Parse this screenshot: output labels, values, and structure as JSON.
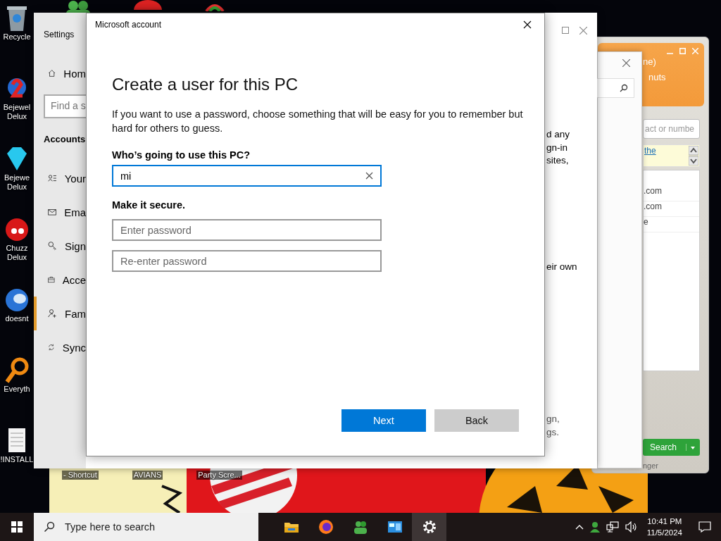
{
  "desktop_icons": [
    {
      "kind": "bin",
      "lines": [
        "Recycle"
      ]
    },
    {
      "kind": "gem",
      "lines": [
        "Bejewel",
        "Delux"
      ]
    },
    {
      "kind": "diamond",
      "lines": [
        "Bejewe",
        "Delux"
      ]
    },
    {
      "kind": "blob",
      "lines": [
        "Chuzz",
        "Delux"
      ]
    },
    {
      "kind": "globe",
      "lines": [
        "doesnt"
      ]
    },
    {
      "kind": "magnifier",
      "lines": [
        "Everyth"
      ]
    },
    {
      "kind": "document",
      "lines": [
        "!INSTALL"
      ]
    }
  ],
  "wallpaper_icon_labels": [
    "- Shortcut",
    "AVIANS",
    "Party Scre..."
  ],
  "settings": {
    "title": "Settings",
    "search_placeholder": "Find a s",
    "section": "Accounts",
    "nav": [
      {
        "kind": "home",
        "label": "Hom",
        "selected": false
      },
      {
        "kind": "person-list",
        "label": "Your",
        "selected": false
      },
      {
        "kind": "mail",
        "label": "Ema",
        "selected": false
      },
      {
        "kind": "key",
        "label": "Sign",
        "selected": false
      },
      {
        "kind": "briefcase",
        "label": "Acce",
        "selected": false
      },
      {
        "kind": "person-add",
        "label": "Fam",
        "selected": true
      },
      {
        "kind": "sync",
        "label": "Sync",
        "selected": false
      }
    ],
    "content_groups": [
      [
        "d any",
        "gn-in",
        "sites,"
      ],
      [
        "eir own"
      ],
      [
        "gn,",
        "gs."
      ]
    ]
  },
  "messenger": {
    "header_lines": [
      "ne)",
      "nuts"
    ],
    "search_placeholder": "act or numbe",
    "notice_link": "the",
    "contacts": [
      ".com",
      ".com",
      "e"
    ],
    "search_button": "Search",
    "status": "nger"
  },
  "dialog": {
    "title": "Microsoft account",
    "heading": "Create a user for this PC",
    "description": "If you want to use a password, choose something that will be easy for you to remember but hard for others to guess.",
    "name_label": "Who’s going to use this PC?",
    "name_value": "mi",
    "secure_label": "Make it secure.",
    "password_placeholders": [
      "Enter password",
      "Re-enter password"
    ],
    "buttons": [
      {
        "kind": "primary",
        "label": "Next"
      },
      {
        "kind": "secondary",
        "label": "Back"
      }
    ]
  },
  "taskbar": {
    "search_placeholder": "Type here to search",
    "apps": [
      {
        "kind": "folder",
        "selected": false
      },
      {
        "kind": "firefox",
        "selected": false
      },
      {
        "kind": "messenger",
        "selected": false
      },
      {
        "kind": "control-panel",
        "selected": false
      },
      {
        "kind": "settings",
        "selected": true
      }
    ],
    "time": "10:41 PM",
    "date": "11/5/2024"
  }
}
